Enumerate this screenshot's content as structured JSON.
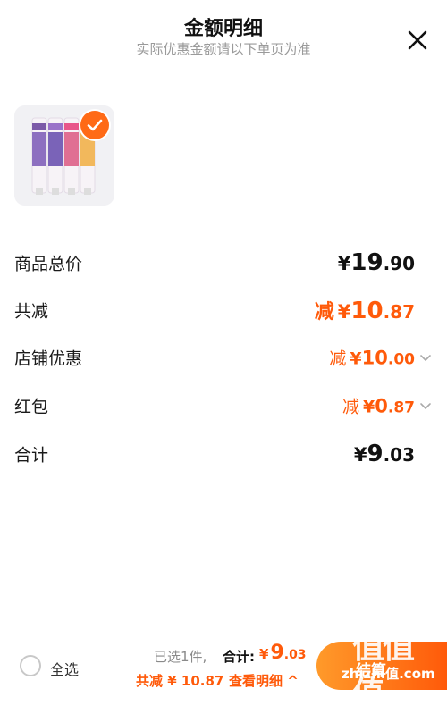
{
  "header": {
    "title": "金额明细",
    "subtitle": "实际优惠金额请以下单页为准"
  },
  "rows": {
    "subtotal": {
      "label": "商品总价",
      "currency": "¥",
      "integer": "19",
      "decimal": ".90"
    },
    "total_discount": {
      "label": "共减",
      "prefix": "减",
      "currency": "¥",
      "integer": "10",
      "decimal": ".87"
    },
    "shop_discount": {
      "label": "店铺优惠",
      "prefix": "减",
      "currency": "¥",
      "integer": "10",
      "decimal": ".00"
    },
    "red_packet": {
      "label": "红包",
      "prefix": "减",
      "currency": "¥",
      "integer": "0",
      "decimal": ".87"
    },
    "total": {
      "label": "合计",
      "currency": "¥",
      "integer": "9",
      "decimal": ".03"
    }
  },
  "footer": {
    "select_all": "全选",
    "selected_count": "已选1件,",
    "total_label": "合计:",
    "total_currency": "¥",
    "total_integer": "9",
    "total_decimal": ".03",
    "discount_summary": "共减 ¥ 10.87",
    "view_detail": "查看明细 ^",
    "checkout": "结算"
  },
  "watermark": {
    "logo": "值值值",
    "text": "zhizhi值.com"
  },
  "colors": {
    "accent": "#ff5a0a",
    "checkout_start": "#ff9a2a",
    "muted": "#9a9a9a"
  },
  "icons": [
    "close-icon",
    "check-icon",
    "chevron-down-icon"
  ]
}
